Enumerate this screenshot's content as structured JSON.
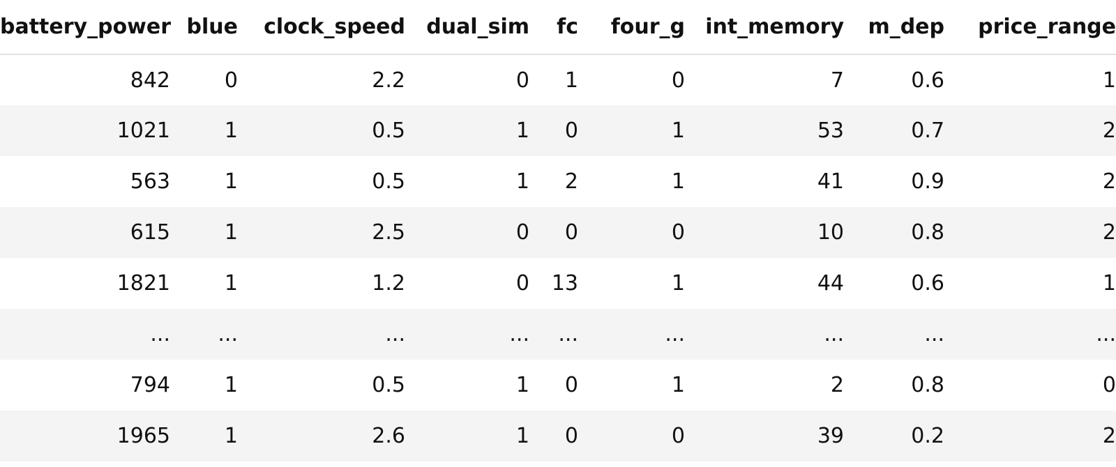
{
  "table": {
    "columns": [
      "battery_power",
      "blue",
      "clock_speed",
      "dual_sim",
      "fc",
      "four_g",
      "int_memory",
      "m_dep",
      "price_range"
    ],
    "rows": [
      [
        "842",
        "0",
        "2.2",
        "0",
        "1",
        "0",
        "7",
        "0.6",
        "1"
      ],
      [
        "1021",
        "1",
        "0.5",
        "1",
        "0",
        "1",
        "53",
        "0.7",
        "2"
      ],
      [
        "563",
        "1",
        "0.5",
        "1",
        "2",
        "1",
        "41",
        "0.9",
        "2"
      ],
      [
        "615",
        "1",
        "2.5",
        "0",
        "0",
        "0",
        "10",
        "0.8",
        "2"
      ],
      [
        "1821",
        "1",
        "1.2",
        "0",
        "13",
        "1",
        "44",
        "0.6",
        "1"
      ],
      [
        "...",
        "...",
        "...",
        "...",
        "...",
        "...",
        "...",
        "...",
        "..."
      ],
      [
        "794",
        "1",
        "0.5",
        "1",
        "0",
        "1",
        "2",
        "0.8",
        "0"
      ],
      [
        "1965",
        "1",
        "2.6",
        "1",
        "0",
        "0",
        "39",
        "0.2",
        "2"
      ]
    ]
  }
}
